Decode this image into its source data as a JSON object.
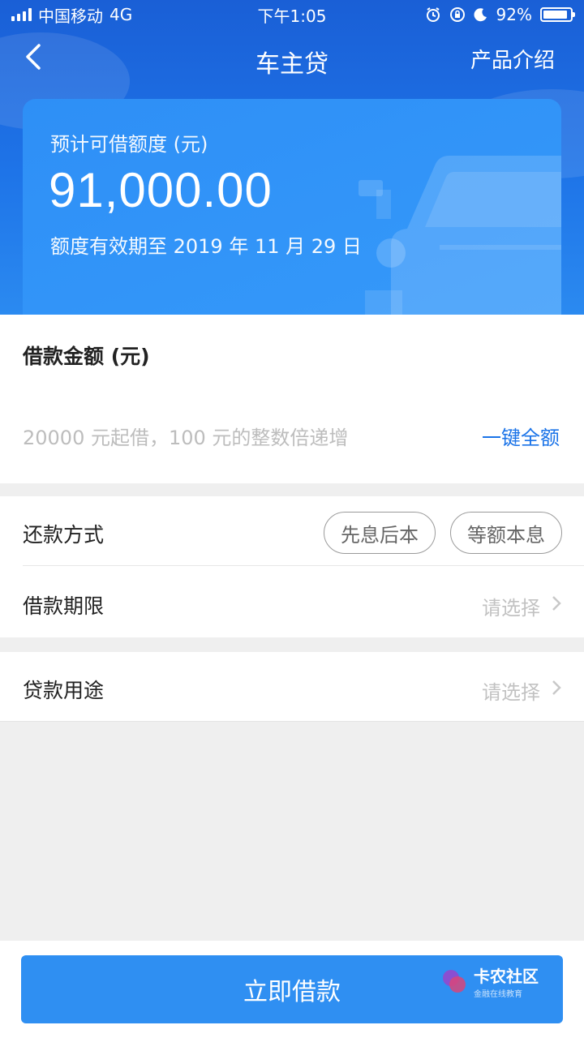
{
  "status_bar": {
    "carrier": "中国移动",
    "network": "4G",
    "time": "下午1:05",
    "battery": "92%",
    "battery_level": 0.92
  },
  "nav": {
    "title": "车主贷",
    "right_link": "产品介绍"
  },
  "credit_card": {
    "label": "预计可借额度 (元)",
    "amount": "91,000.00",
    "expiry": "额度有效期至 2019 年 11 月 29 日"
  },
  "loan_amount": {
    "title": "借款金额 (元)",
    "placeholder": "20000 元起借，100 元的整数倍递增",
    "full_amount_link": "一键全额"
  },
  "repayment": {
    "label": "还款方式",
    "options": [
      "先息后本",
      "等额本息"
    ]
  },
  "term": {
    "label": "借款期限",
    "value": "请选择"
  },
  "purpose": {
    "label": "贷款用途",
    "value": "请选择"
  },
  "submit": {
    "label": "立即借款"
  },
  "watermark": {
    "name": "卡农社区",
    "tagline": "金融在线教育"
  },
  "colors": {
    "header_blue": "#1e74e8",
    "card_blue": "#3599fa",
    "link_blue": "#1a73e8",
    "button_blue": "#2f8ff2"
  }
}
